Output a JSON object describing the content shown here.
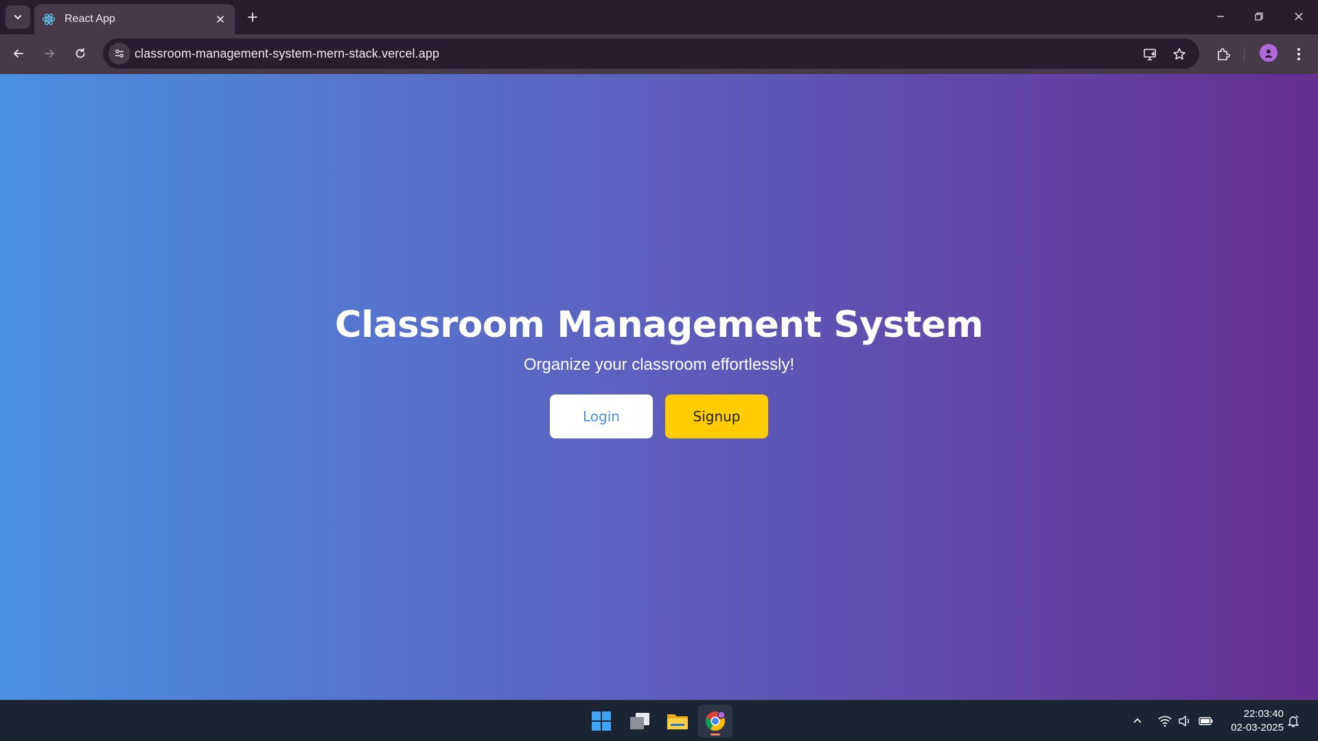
{
  "browser": {
    "tab": {
      "title": "React App",
      "favicon": "react-icon"
    },
    "address_bar": {
      "url": "classroom-management-system-mern-stack.vercel.app"
    }
  },
  "page": {
    "title": "Classroom Management System",
    "subtitle": "Organize your classroom effortlessly!",
    "login_label": "Login",
    "signup_label": "Signup",
    "colors": {
      "gradient_start": "#4a90e2",
      "gradient_end": "#652f92",
      "signup_button": "#ffcc00",
      "login_text": "#4a90e2"
    }
  },
  "taskbar": {
    "apps": [
      "windows-start-icon",
      "task-view-icon",
      "file-explorer-icon",
      "chrome-icon"
    ],
    "time": "22:03:40",
    "date": "02-03-2025"
  }
}
